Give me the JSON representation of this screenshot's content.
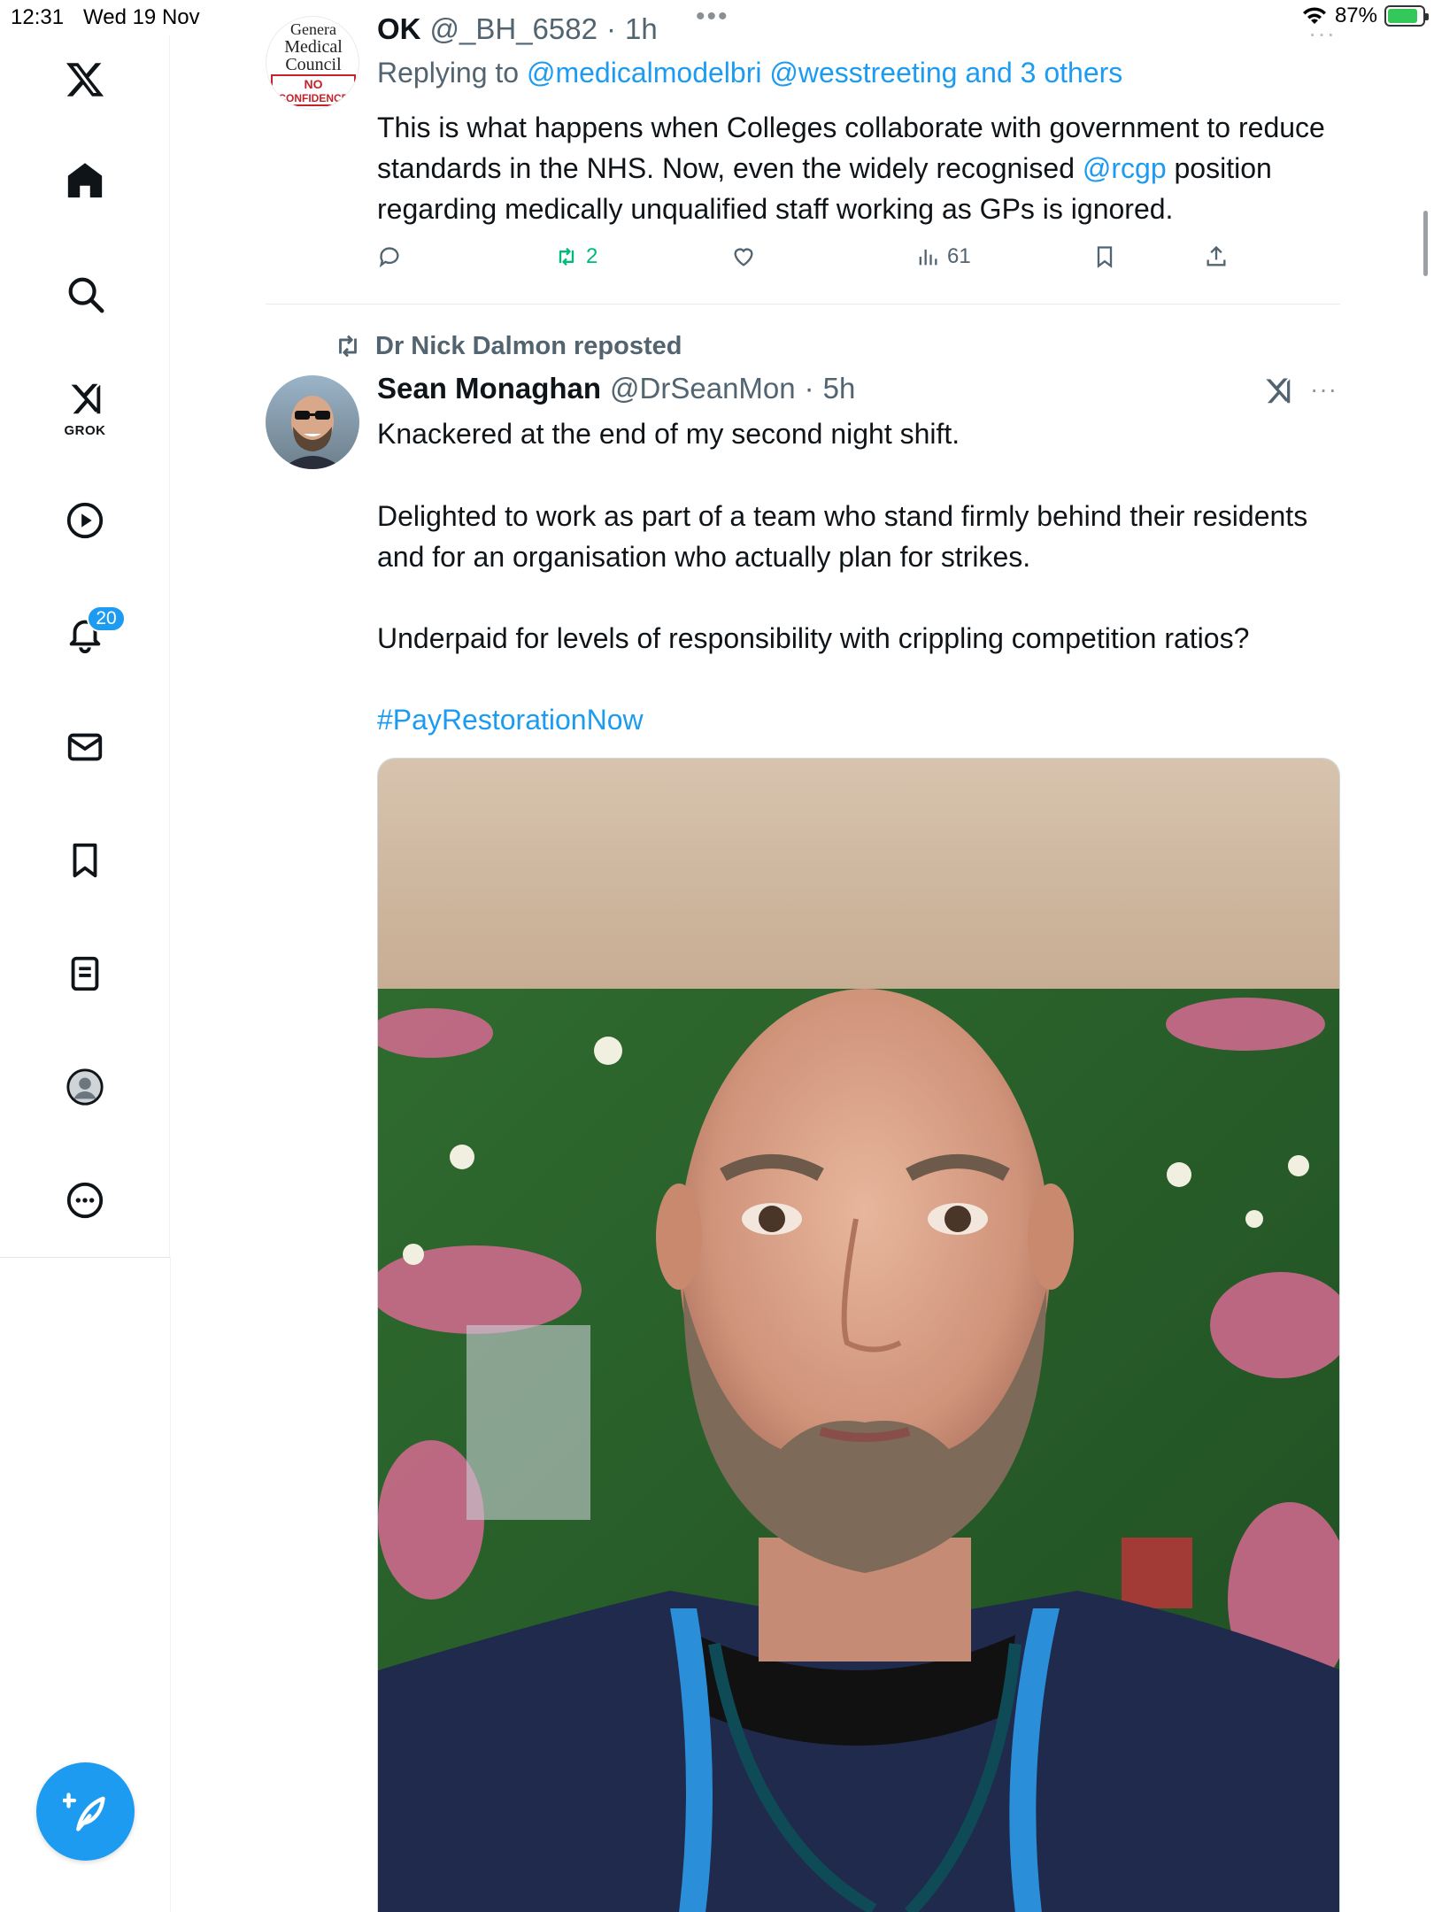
{
  "status_bar": {
    "time": "12:31",
    "date": "Wed 19 Nov",
    "battery": "87%",
    "battery_level": 0.87
  },
  "sidebar": {
    "grok_label": "GROK",
    "notifications_badge": "20",
    "items": [
      {
        "name": "x-logo-icon"
      },
      {
        "name": "home-icon"
      },
      {
        "name": "search-icon"
      },
      {
        "name": "grok-icon"
      },
      {
        "name": "video-icon"
      },
      {
        "name": "bell-icon"
      },
      {
        "name": "mail-icon"
      },
      {
        "name": "bookmark-icon"
      },
      {
        "name": "lists-icon"
      },
      {
        "name": "profile-icon"
      },
      {
        "name": "more-icon"
      }
    ],
    "compose_icon": "feather-plus-icon"
  },
  "tweet1": {
    "avatar_text": [
      "Genera",
      "Medical",
      "Council",
      "NO",
      "CONFIDENCE"
    ],
    "display_name": "OK",
    "handle": "@_BH_6582",
    "sep": "·",
    "time": "1h",
    "replying_prefix": "Replying to",
    "replying_to": "@medicalmodelbri @wesstreeting and 3 others",
    "text_before_mention": "This is what happens when Colleges collaborate with government to reduce standards in the NHS. Now, even the widely recognised ",
    "mention": "@rcgp",
    "text_after_mention": " position regarding medically unqualified staff working as GPs is ignored.",
    "reposts": "2",
    "views": "61",
    "more": "···"
  },
  "tweet2": {
    "reposted_by": "Dr Nick Dalmon reposted",
    "display_name": "Sean Monaghan",
    "handle": "@DrSeanMon",
    "sep": "·",
    "time": "5h",
    "more": "···",
    "line1": "Knackered at the end of my second night shift.",
    "line2": "Delighted to work as part of a team who stand firmly behind their residents and for an organisation who actually plan for strikes.",
    "line3": "Underpaid for levels of responsibility with crippling competition ratios?",
    "hashtag": "#PayRestorationNow"
  },
  "colors": {
    "accent": "#1d9bf0",
    "repost_green": "#00ba7c",
    "secondary_text": "#536471"
  }
}
